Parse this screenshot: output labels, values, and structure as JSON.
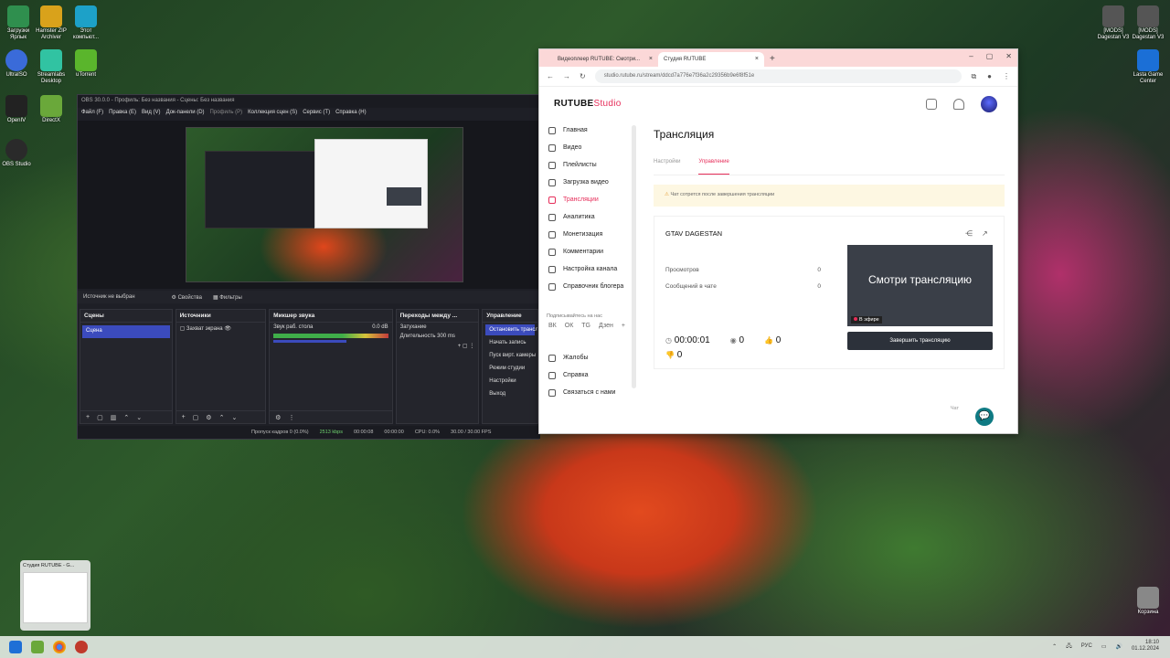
{
  "desktop": {
    "icons_left": [
      {
        "label": "Загрузки Ярлык",
        "color": "#2f8f4e"
      },
      {
        "label": "Hamster ZIP Archiver",
        "color": "#d9a21b"
      },
      {
        "label": "Этот компьют...",
        "color": "#1da1c8"
      },
      {
        "label": "UltraISO",
        "color": "#3a6bd9"
      },
      {
        "label": "Streamlabs Desktop",
        "color": "#31c3a2"
      },
      {
        "label": "uTorrent",
        "color": "#5ab52c"
      },
      {
        "label": "OpenIV",
        "color": "#222222"
      },
      {
        "label": "DirectX",
        "color": "#6aa83a"
      },
      {
        "label": "OBS Studio",
        "color": "#2a2a2a"
      }
    ],
    "icons_right": [
      {
        "label": "[MODS] Dagestan V3",
        "color": "#555"
      },
      {
        "label": "[MODS] Dagestan V3",
        "color": "#555"
      },
      {
        "label": "Lasta Game Center",
        "color": "#1b6fd6"
      },
      {
        "label": "Корзина",
        "color": "#888"
      }
    ]
  },
  "obs": {
    "title": "OBS 30.0.0 - Профиль: Без названия - Сцены: Без названия",
    "menu": [
      "Файл (F)",
      "Правка (E)",
      "Вид (V)",
      "Док-панели (D)",
      "Профиль (P)",
      "Коллекция сцен (S)",
      "Сервис (T)",
      "Справка (H)"
    ],
    "toolbar": {
      "no_source": "Источник не выбран",
      "properties": "Свойства",
      "filters": "Фильтры"
    },
    "scenes": {
      "title": "Сцены",
      "selected": "Сцена"
    },
    "sources": {
      "title": "Источники",
      "item": "Захват экрана"
    },
    "mixer": {
      "title": "Микшер звука",
      "track": "Звук раб. стола",
      "db": "0.0 dB"
    },
    "transitions": {
      "title": "Переходы между ...",
      "type": "Затухание",
      "duration_label": "Длительность",
      "duration": "300 ms"
    },
    "controls": {
      "title": "Управление",
      "buttons": [
        "Остановить трансляцию",
        "Начать запись",
        "Пуск вирт. камеры",
        "Режим студии",
        "Настройки",
        "Выход"
      ]
    },
    "status": {
      "dropped": "Пропуск кадров 0 (0.0%)",
      "bitrate": "2513 kbps",
      "stream_time": "00:00:08",
      "rec_time": "00:00:00",
      "cpu": "CPU: 0.0%",
      "fps": "30.00 / 30.00 FPS"
    }
  },
  "browser": {
    "tabs": [
      {
        "label": "Видеоплеер RUTUBE: Смотри..."
      },
      {
        "label": "Студия RUTUBE"
      }
    ],
    "url": "studio.rutube.ru/stream/ddcd7a776e7f36a2c29356b9e6f8f51e",
    "logo": {
      "main": "RUTUBE",
      "sub": "Studio"
    },
    "sidebar": {
      "items": [
        {
          "label": "Главная",
          "active": false
        },
        {
          "label": "Видео",
          "active": false
        },
        {
          "label": "Плейлисты",
          "active": false
        },
        {
          "label": "Загрузка видео",
          "active": false
        },
        {
          "label": "Трансляции",
          "active": true
        },
        {
          "label": "Аналитика",
          "active": false
        },
        {
          "label": "Монетизация",
          "active": false
        },
        {
          "label": "Комментарии",
          "active": false
        },
        {
          "label": "Настройка канала",
          "active": false
        },
        {
          "label": "Справочник блогера",
          "active": false
        }
      ],
      "follow_label": "Подписывайтесь на нас",
      "socials": [
        "ВК",
        "ОК",
        "TG",
        "Дзен",
        "+"
      ],
      "bottom_items": [
        {
          "label": "Жалобы"
        },
        {
          "label": "Справка"
        },
        {
          "label": "Связаться с нами"
        }
      ]
    },
    "main": {
      "title": "Трансляция",
      "tabs": [
        "Настройки",
        "Управление"
      ],
      "notice": "Чат сотрется после завершения трансляции",
      "stream_title": "GTAV DAGESTAN",
      "stats": [
        {
          "label": "Просмотров",
          "value": "0"
        },
        {
          "label": "Сообщений в чате",
          "value": "0"
        }
      ],
      "duration": "00:00:01",
      "viewers": "0",
      "likes": "0",
      "dislikes": "0",
      "thumb_text": "Смотри трансляцию",
      "live_badge": "В эфире",
      "end_button": "Завершить трансляцию",
      "chat_label": "Чат"
    }
  },
  "taskbar": {
    "preview_title": "Студия RUTUBE - G...",
    "lang": "РУС",
    "time": "18:10",
    "date": "01.12.2024"
  }
}
